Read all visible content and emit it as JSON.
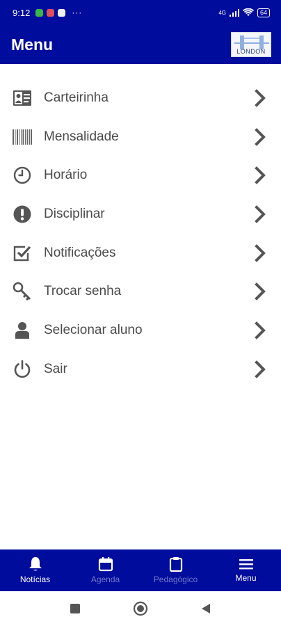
{
  "status_bar": {
    "time": "9:12",
    "dots": "···",
    "network": "4G",
    "battery": "64"
  },
  "header": {
    "title": "Menu",
    "logo_text": "LONDON"
  },
  "menu": {
    "items": [
      {
        "label": "Carteirinha",
        "icon": "id-card-icon"
      },
      {
        "label": "Mensalidade",
        "icon": "barcode-icon"
      },
      {
        "label": "Horário",
        "icon": "clock-icon"
      },
      {
        "label": "Disciplinar",
        "icon": "exclamation-icon"
      },
      {
        "label": "Notificações",
        "icon": "checkbox-icon"
      },
      {
        "label": "Trocar senha",
        "icon": "key-icon"
      },
      {
        "label": "Selecionar aluno",
        "icon": "user-icon"
      },
      {
        "label": "Sair",
        "icon": "power-icon"
      }
    ]
  },
  "tabs": [
    {
      "label": "Notícias",
      "icon": "bell-icon",
      "state": "active"
    },
    {
      "label": "Agenda",
      "icon": "calendar-icon",
      "state": "inactive"
    },
    {
      "label": "Pedagógico",
      "icon": "clipboard-icon",
      "state": "inactive"
    },
    {
      "label": "Menu",
      "icon": "hamburger-icon",
      "state": "active"
    }
  ],
  "colors": {
    "primary": "#000c9c",
    "tab_inactive": "#6f78c9",
    "menu_text": "#4a4a4a",
    "icon": "#555555"
  }
}
